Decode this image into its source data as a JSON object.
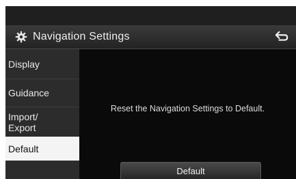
{
  "header": {
    "title": "Navigation Settings",
    "settings_icon": "gear-icon",
    "back_icon": "back-arrow-icon"
  },
  "sidebar": {
    "items": [
      {
        "label": "Display",
        "active": false
      },
      {
        "label": "Guidance",
        "active": false
      },
      {
        "label": "Import/\nExport",
        "active": false
      },
      {
        "label": "Default",
        "active": true
      }
    ]
  },
  "main": {
    "message": "Reset the Navigation Settings to Default.",
    "default_button_label": "Default"
  },
  "colors": {
    "background": "#0d0d0d",
    "header": "#2e2e2e",
    "sidebar": "#2c2c2c",
    "active_item": "#f4f4f4"
  }
}
